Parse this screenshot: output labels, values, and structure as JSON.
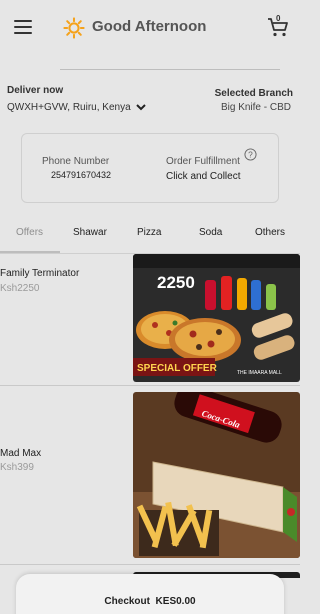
{
  "header": {
    "greeting": "Good Afternoon",
    "cart_badge": "0"
  },
  "delivery": {
    "label": "Deliver now",
    "address": "QWXH+GVW, Ruiru, Kenya",
    "branch_label": "Selected Branch",
    "branch_name": "Big Knife - CBD"
  },
  "info": {
    "phone_label": "Phone Number",
    "phone_value": "254791670432",
    "fulfillment_label": "Order Fulfillment",
    "fulfillment_value": "Click and Collect"
  },
  "tabs": [
    {
      "label": "Offers",
      "active": true
    },
    {
      "label": "Shawar",
      "active": false
    },
    {
      "label": "Pizza",
      "active": false
    },
    {
      "label": "Soda",
      "active": false
    },
    {
      "label": "Others",
      "active": false
    }
  ],
  "items": [
    {
      "name": "Family Terminator",
      "price": "Ksh2250",
      "image": {
        "price_tag": "2250",
        "ribbon": "SPECIAL OFFER",
        "footer": "THE IMAARA MALL"
      }
    },
    {
      "name": "Mad Max",
      "price": "Ksh399",
      "image": {
        "bottle_label": "Coca-Cola"
      }
    }
  ],
  "checkout": {
    "label": "Checkout",
    "amount": "KES0.00"
  },
  "colors": {
    "background": "#e6e6e6",
    "sun": "#f5a21b",
    "offer_red": "#c8102e"
  }
}
